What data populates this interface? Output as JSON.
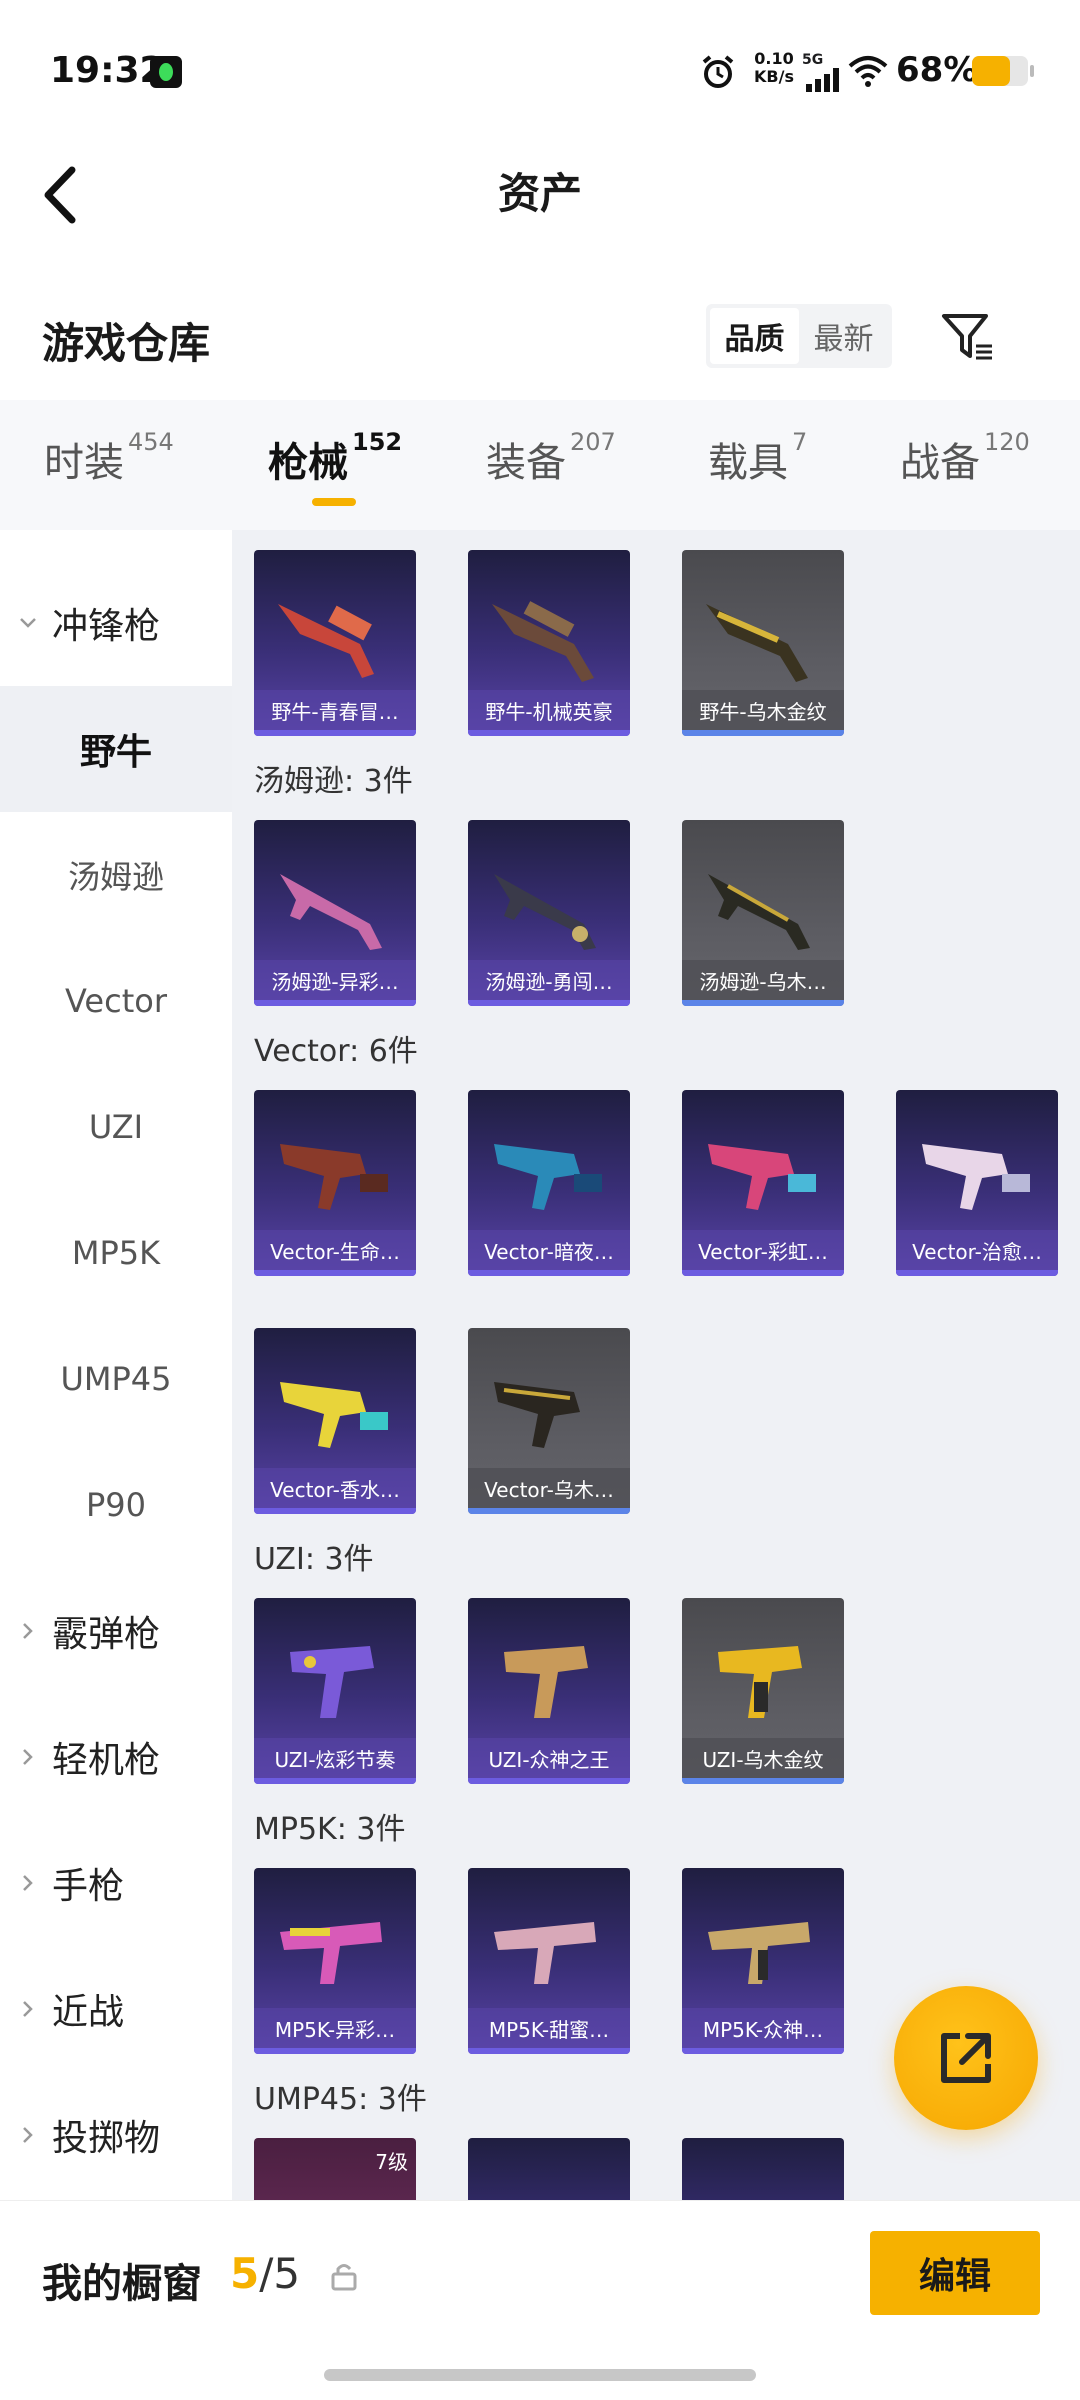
{
  "status": {
    "time": "19:32",
    "net_speed_value": "0.10",
    "net_speed_unit": "KB/s",
    "signal": "5G",
    "battery": "68%",
    "battery_level": 0.68
  },
  "nav": {
    "title": "资产"
  },
  "header": {
    "title": "游戏仓库",
    "sort": [
      "品质",
      "最新"
    ],
    "sort_active": 0
  },
  "tabs": [
    {
      "label": "时装",
      "count": "454"
    },
    {
      "label": "枪械",
      "count": "152"
    },
    {
      "label": "装备",
      "count": "207"
    },
    {
      "label": "载具",
      "count": "7"
    },
    {
      "label": "战备",
      "count": "120"
    }
  ],
  "active_tab": 1,
  "sidebar": [
    {
      "label": "冲锋枪",
      "type": "category",
      "expanded": true
    },
    {
      "label": "野牛",
      "type": "sub",
      "active": true
    },
    {
      "label": "汤姆逊",
      "type": "sub"
    },
    {
      "label": "Vector",
      "type": "sub"
    },
    {
      "label": "UZI",
      "type": "sub"
    },
    {
      "label": "MP5K",
      "type": "sub"
    },
    {
      "label": "UMP45",
      "type": "sub"
    },
    {
      "label": "P90",
      "type": "sub"
    },
    {
      "label": "霰弹枪",
      "type": "category"
    },
    {
      "label": "轻机枪",
      "type": "category"
    },
    {
      "label": "手枪",
      "type": "category"
    },
    {
      "label": "近战",
      "type": "category"
    },
    {
      "label": "投掷物",
      "type": "category"
    }
  ],
  "groups": {
    "bison": {
      "items": [
        "野牛-青春冒…",
        "野牛-机械英豪",
        "野牛-乌木金纹"
      ]
    },
    "thompson": {
      "title": "汤姆逊: 3件",
      "items": [
        "汤姆逊-异彩…",
        "汤姆逊-勇闯…",
        "汤姆逊-乌木…"
      ]
    },
    "vector": {
      "title": "Vector: 6件",
      "items": [
        "Vector-生命…",
        "Vector-暗夜…",
        "Vector-彩虹…",
        "Vector-治愈…",
        "Vector-香水…",
        "Vector-乌木…"
      ]
    },
    "uzi": {
      "title": "UZI: 3件",
      "items": [
        "UZI-炫彩节奏",
        "UZI-众神之王",
        "UZI-乌木金纹"
      ]
    },
    "mp5k": {
      "title": "MP5K: 3件",
      "items": [
        "MP5K-异彩…",
        "MP5K-甜蜜…",
        "MP5K-众神…"
      ]
    },
    "ump45": {
      "title": "UMP45: 3件",
      "first_level": "7级"
    }
  },
  "bottom": {
    "title": "我的橱窗",
    "count_current": "5",
    "count_total": "/5",
    "edit": "编辑"
  },
  "colors": {
    "accent": "#f6b100",
    "card_purple": "#3a2f78",
    "card_gray": "#5c5c62"
  },
  "icons": [
    "back-icon",
    "filter-icon",
    "lock-icon",
    "share-icon",
    "alarm-icon",
    "wifi-icon"
  ]
}
